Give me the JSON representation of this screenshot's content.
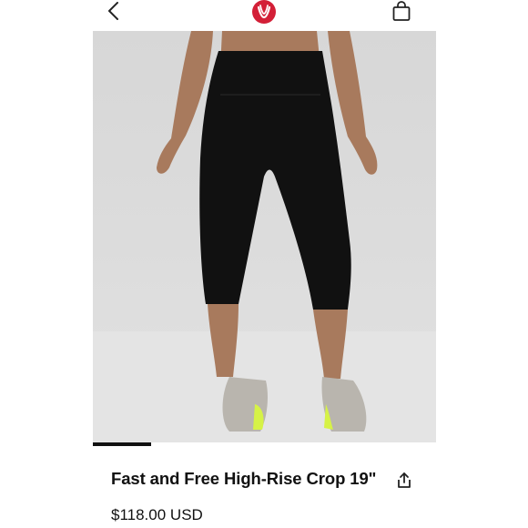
{
  "header": {
    "back_icon": "chevron-left-icon",
    "logo_icon": "lululemon-logo",
    "bag_icon": "shopping-bag-icon",
    "brand_color": "#d31f37"
  },
  "carousel": {
    "progress": 0.17,
    "slide_description_icon": "product-photo"
  },
  "product": {
    "title": "Fast and Free High-Rise Crop 19\"",
    "price": "$118.00 USD",
    "share_icon": "share-icon"
  }
}
